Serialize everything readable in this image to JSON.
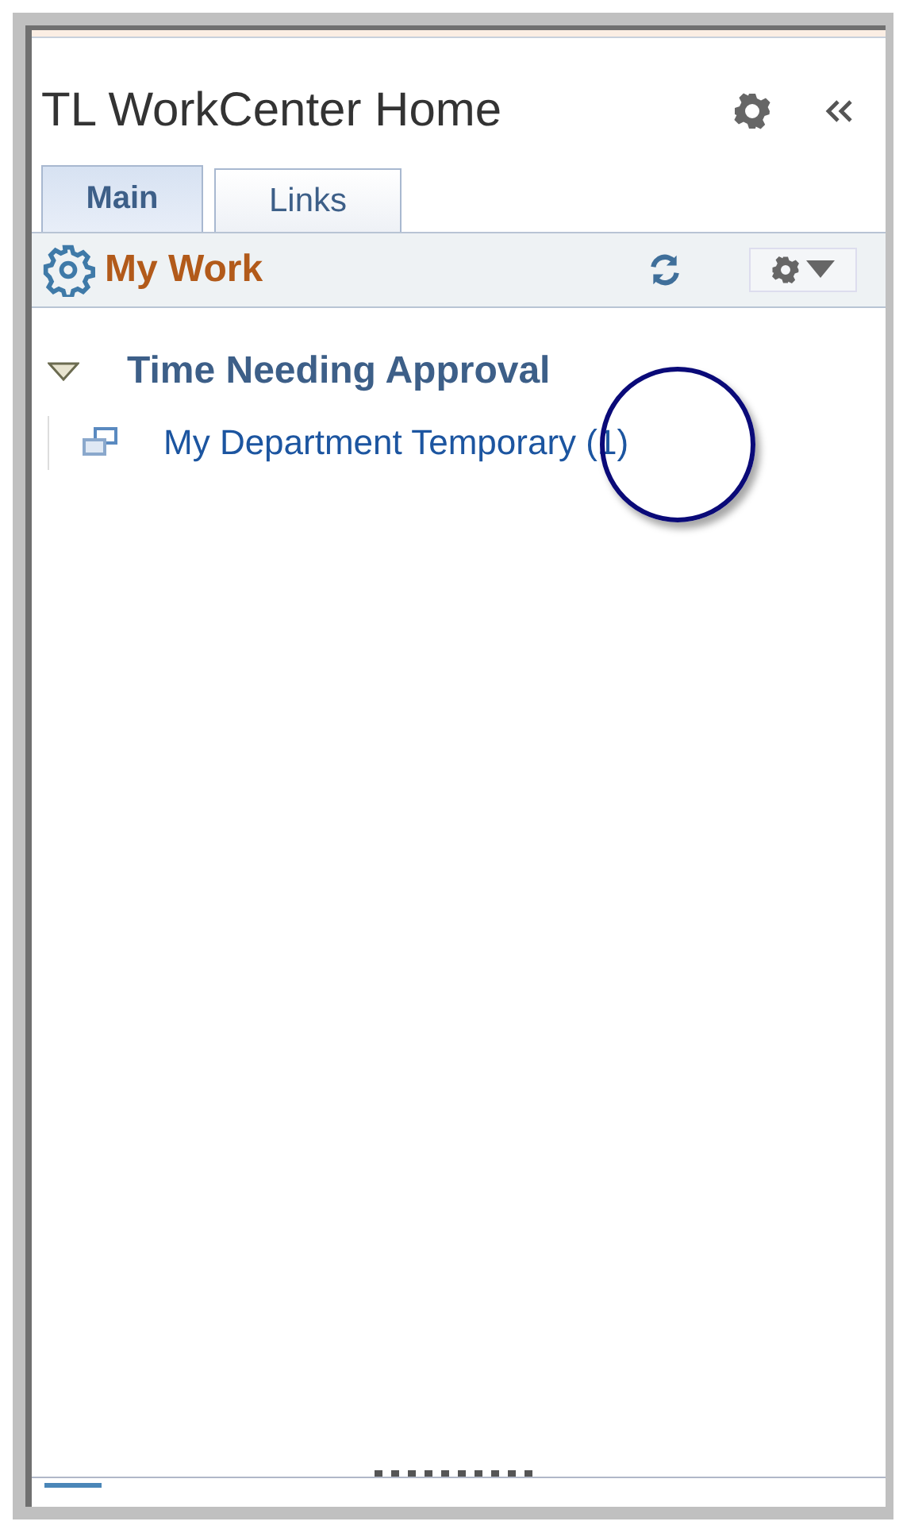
{
  "header": {
    "title": "TL WorkCenter Home"
  },
  "tabs": [
    {
      "label": "Main",
      "selected": true
    },
    {
      "label": "Links",
      "selected": false
    }
  ],
  "pagelet": {
    "title": "My Work"
  },
  "tree": [
    {
      "label": "Time Needing Approval",
      "expanded": true,
      "children": [
        {
          "label": "My Department Temporary (1)"
        }
      ]
    }
  ]
}
